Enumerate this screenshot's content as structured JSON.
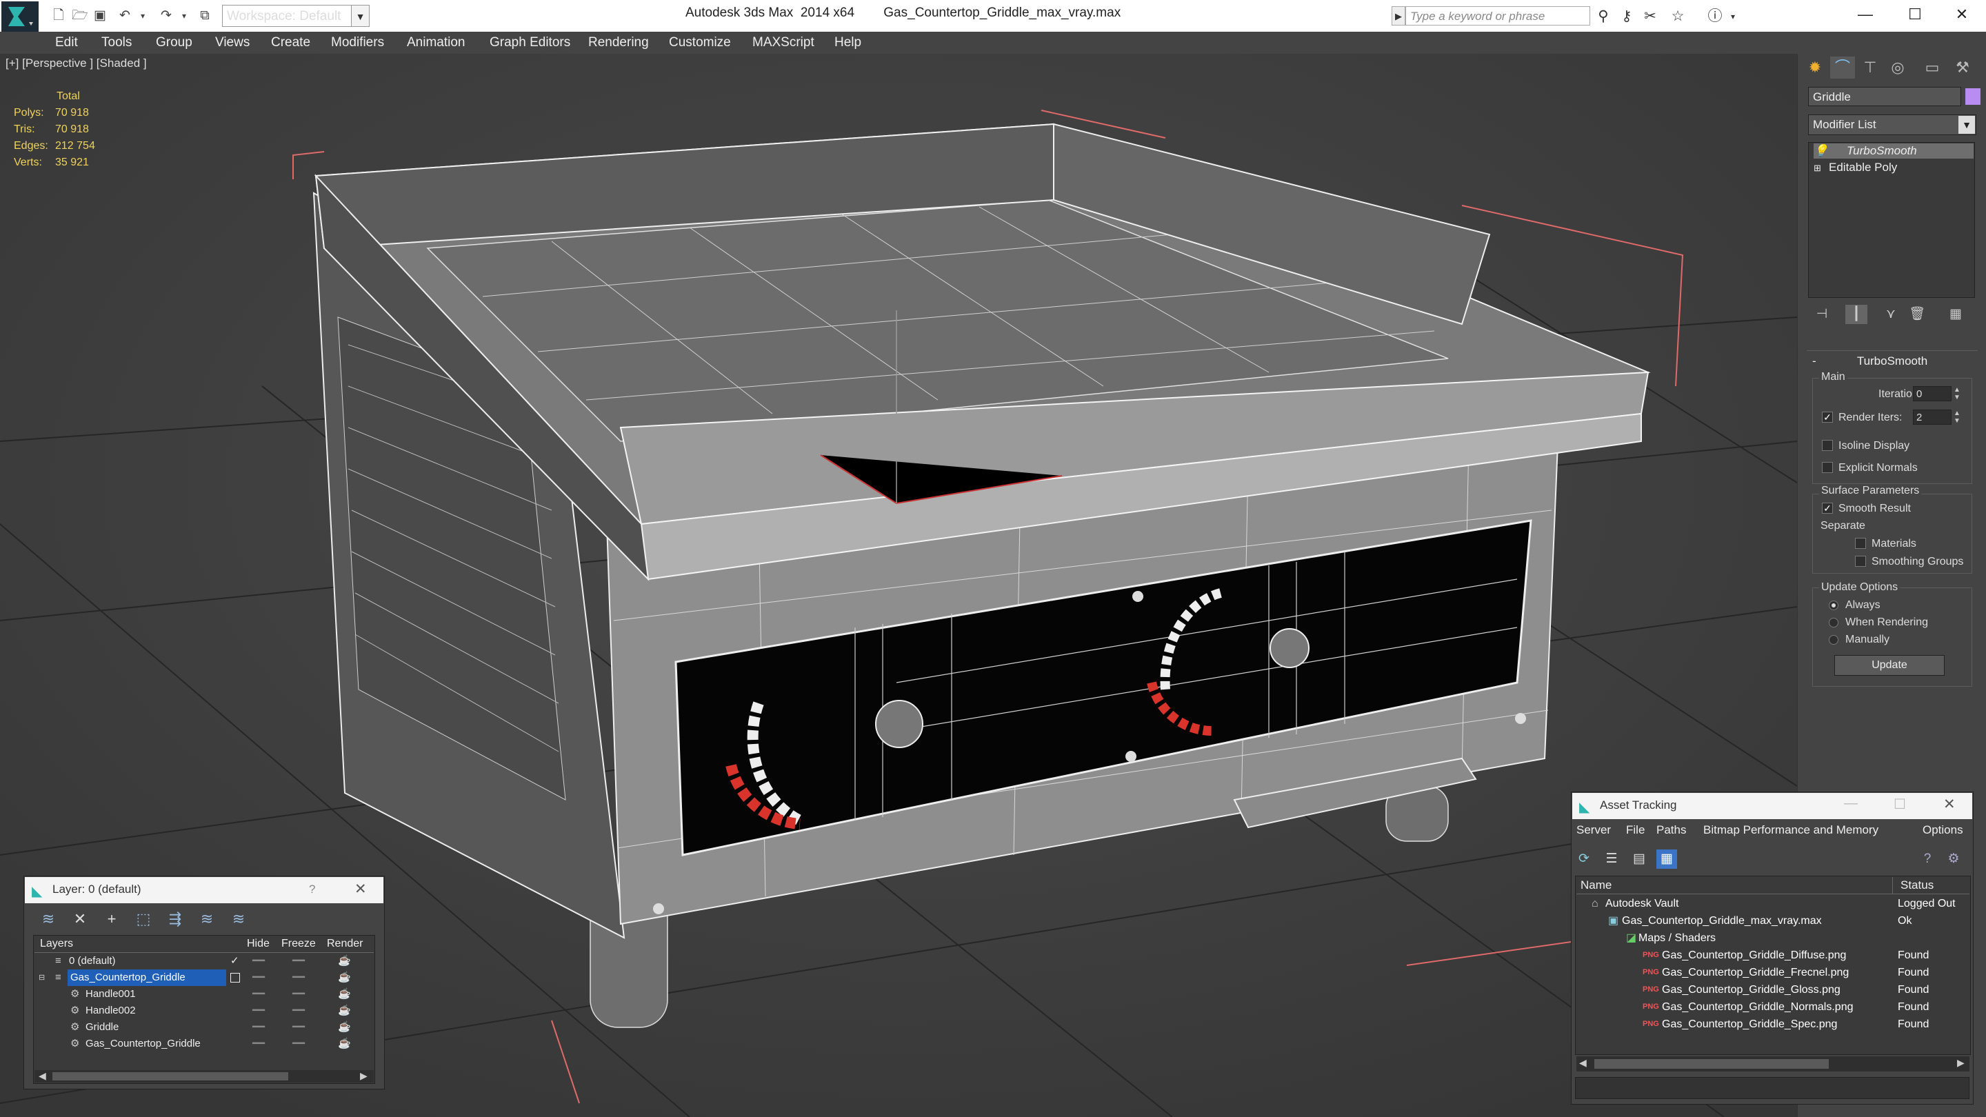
{
  "window": {
    "app_title": "Autodesk 3ds Max  2014 x64",
    "file_title": "Gas_Countertop_Griddle_max_vray.max",
    "workspace": "Workspace: Default",
    "search_placeholder": "Type a keyword or phrase"
  },
  "menu": [
    "Edit",
    "Tools",
    "Group",
    "Views",
    "Create",
    "Modifiers",
    "Animation",
    "Graph Editors",
    "Rendering",
    "Customize",
    "MAXScript",
    "Help"
  ],
  "viewport": {
    "label": "[+] [Perspective ] [Shaded ]",
    "stats": {
      "header": "Total",
      "rows": [
        {
          "k": "Polys:",
          "v": "70 918"
        },
        {
          "k": "Tris:",
          "v": "70 918"
        },
        {
          "k": "Edges:",
          "v": "212 754"
        },
        {
          "k": "Verts:",
          "v": "35 921"
        }
      ]
    }
  },
  "command_panel": {
    "object_name": "Griddle",
    "object_color": "#b88cf0",
    "modifier_list": "Modifier List",
    "stack": [
      "TurboSmooth",
      "Editable Poly"
    ],
    "rollout": "TurboSmooth",
    "main_group": "Main",
    "iterations_label": "Iterations:",
    "iterations_value": "0",
    "render_iters_label": "Render Iters:",
    "render_iters_value": "2",
    "render_iters_checked": true,
    "isoline_label": "Isoline Display",
    "explicit_normals_label": "Explicit Normals",
    "surface_group": "Surface Parameters",
    "smooth_result_label": "Smooth Result",
    "smooth_result_checked": true,
    "separate_label": "Separate",
    "materials_label": "Materials",
    "smoothing_groups_label": "Smoothing Groups",
    "update_group": "Update Options",
    "always_label": "Always",
    "when_rendering_label": "When Rendering",
    "manually_label": "Manually",
    "update_button": "Update"
  },
  "layer_window": {
    "title": "Layer: 0 (default)",
    "help": "?",
    "columns": {
      "layers": "Layers",
      "hide": "Hide",
      "freeze": "Freeze",
      "render": "Render"
    },
    "rows": [
      {
        "name": "0 (default)",
        "indent": 1,
        "selected": false
      },
      {
        "name": "Gas_Countertop_Griddle",
        "indent": 1,
        "selected": true
      },
      {
        "name": "Handle001",
        "indent": 2,
        "selected": false
      },
      {
        "name": "Handle002",
        "indent": 2,
        "selected": false
      },
      {
        "name": "Griddle",
        "indent": 2,
        "selected": false
      },
      {
        "name": "Gas_Countertop_Griddle",
        "indent": 2,
        "selected": false
      }
    ]
  },
  "asset_window": {
    "title": "Asset Tracking",
    "menu": [
      "Server",
      "File",
      "Paths",
      "Bitmap Performance and Memory",
      "Options"
    ],
    "columns": {
      "name": "Name",
      "status": "Status"
    },
    "rows": [
      {
        "name": "Autodesk Vault",
        "status": "Logged Out",
        "indent": 1
      },
      {
        "name": "Gas_Countertop_Griddle_max_vray.max",
        "status": "Ok",
        "indent": 2
      },
      {
        "name": "Maps / Shaders",
        "status": "",
        "indent": 3
      },
      {
        "name": "Gas_Countertop_Griddle_Diffuse.png",
        "status": "Found",
        "indent": 4
      },
      {
        "name": "Gas_Countertop_Griddle_Frecnel.png",
        "status": "Found",
        "indent": 4
      },
      {
        "name": "Gas_Countertop_Griddle_Gloss.png",
        "status": "Found",
        "indent": 4
      },
      {
        "name": "Gas_Countertop_Griddle_Normals.png",
        "status": "Found",
        "indent": 4
      },
      {
        "name": "Gas_Countertop_Griddle_Spec.png",
        "status": "Found",
        "indent": 4
      }
    ]
  }
}
